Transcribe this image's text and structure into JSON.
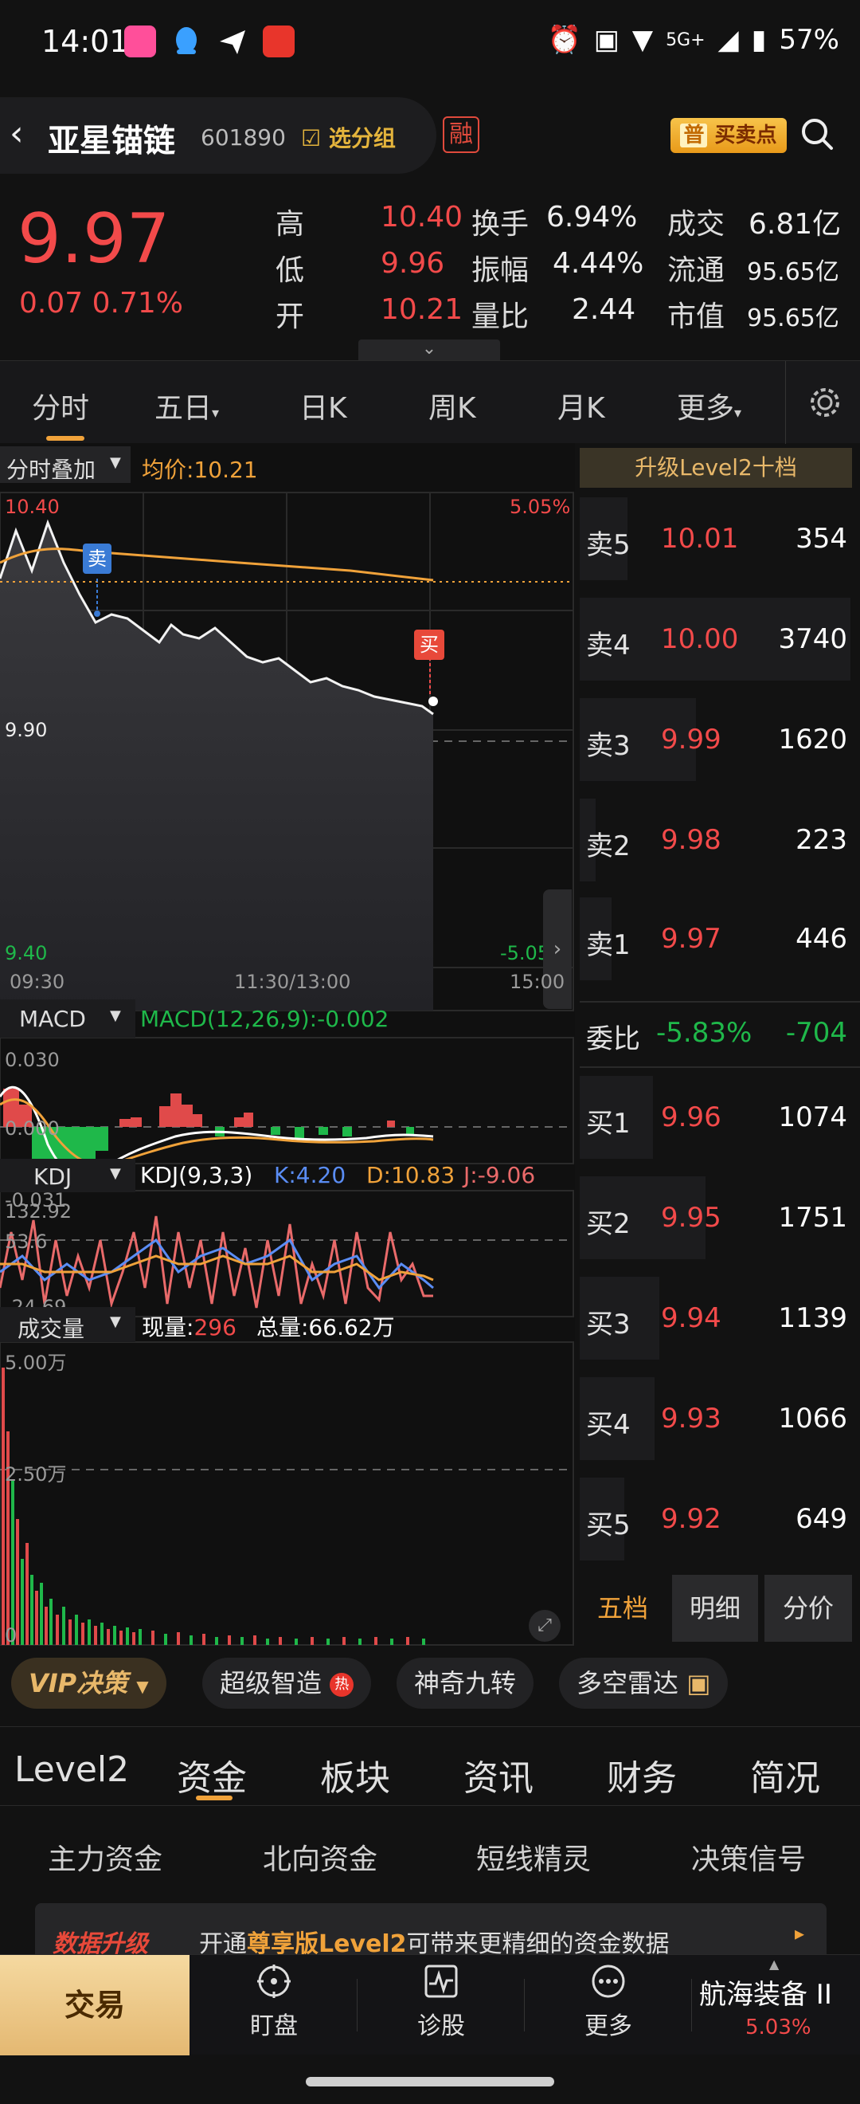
{
  "status": {
    "time": "14:01",
    "network": "5G+",
    "battery": "57%"
  },
  "stock": {
    "name": "亚星锚链",
    "code": "601890",
    "watch_label": "选分组",
    "margin_badge": "融",
    "buysell_prefix": "普",
    "buysell_label": "买卖点"
  },
  "price": {
    "last": "9.97",
    "change": "0.07",
    "change_pct": "0.71%"
  },
  "quote": {
    "high_label": "高",
    "high": "10.40",
    "low_label": "低",
    "low": "9.96",
    "open_label": "开",
    "open": "10.21",
    "turnover_label": "换手",
    "turnover": "6.94%",
    "amplitude_label": "振幅",
    "amplitude": "4.44%",
    "volratio_label": "量比",
    "volratio": "2.44",
    "amount_label": "成交",
    "amount": "6.81亿",
    "float_label": "流通",
    "float": "95.65亿",
    "mktcap_label": "市值",
    "mktcap": "95.65亿"
  },
  "period_tabs": [
    "分时",
    "五日",
    "日K",
    "周K",
    "月K",
    "更多"
  ],
  "chart": {
    "overlay_label": "分时叠加",
    "avg_label": "均价:10.21",
    "price_top": "10.40",
    "price_mid": "9.90",
    "price_bottom": "9.40",
    "pct_top": "5.05%",
    "pct_bottom": "-5.05%",
    "time_start": "09:30",
    "time_mid": "11:30/13:00",
    "time_end": "15:00",
    "sell_marker": "卖",
    "buy_marker": "买",
    "macd_label": "MACD",
    "macd_params": "MACD(12,26,9):-0.002",
    "macd_top": "0.030",
    "macd_zero": "0.000",
    "macd_bottom": "-0.031",
    "kdj_label": "KDJ",
    "kdj_params": "KDJ(9,3,3)",
    "kdj_k": "K:4.20",
    "kdj_d": "D:10.83",
    "kdj_j": "J:-9.06",
    "kdj_top": "132.92",
    "kdj_mid": "53.6",
    "kdj_bottom": "-24.69",
    "vol_label": "成交量",
    "vol_now_label": "现量:",
    "vol_now": "296",
    "vol_total": "总量:66.62万",
    "vol_top": "5.00万",
    "vol_mid": "2.50万",
    "vol_zero": "0"
  },
  "orderbook": {
    "header": "升级Level2十档",
    "asks": [
      {
        "label": "卖5",
        "price": "10.01",
        "vol": "354"
      },
      {
        "label": "卖4",
        "price": "10.00",
        "vol": "3740"
      },
      {
        "label": "卖3",
        "price": "9.99",
        "vol": "1620"
      },
      {
        "label": "卖2",
        "price": "9.98",
        "vol": "223"
      },
      {
        "label": "卖1",
        "price": "9.97",
        "vol": "446"
      }
    ],
    "ratio_label": "委比",
    "ratio_pct": "-5.83%",
    "ratio_diff": "-704",
    "bids": [
      {
        "label": "买1",
        "price": "9.96",
        "vol": "1074"
      },
      {
        "label": "买2",
        "price": "9.95",
        "vol": "1751"
      },
      {
        "label": "买3",
        "price": "9.94",
        "vol": "1139"
      },
      {
        "label": "买4",
        "price": "9.93",
        "vol": "1066"
      },
      {
        "label": "买5",
        "price": "9.92",
        "vol": "649"
      }
    ],
    "tabs": [
      "五档",
      "明细",
      "分价"
    ]
  },
  "tools": {
    "vip": "VIP决策",
    "t1": "超级智造",
    "t2": "神奇九转",
    "t3": "多空雷达",
    "hot": "热"
  },
  "section_tabs": [
    "Level2",
    "资金",
    "板块",
    "资讯",
    "财务",
    "简况"
  ],
  "sub_tabs": [
    "主力资金",
    "北向资金",
    "短线精灵",
    "决策信号"
  ],
  "upgrade": {
    "title": "数据升级",
    "pre": "开通",
    "highlight": "尊享版Level2",
    "post": "可带来更精细的资金数据"
  },
  "nav": {
    "trade": "交易",
    "watch": "盯盘",
    "diagnose": "诊股",
    "more": "更多",
    "sector": "航海装备 II",
    "sector_pct": "5.03%"
  }
}
